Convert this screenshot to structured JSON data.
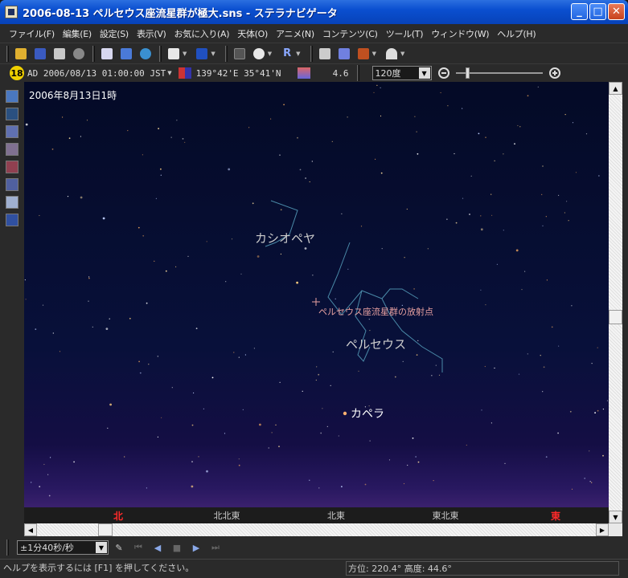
{
  "window": {
    "title": "2006-08-13 ペルセウス座流星群が極大.sns - ステラナビゲータ"
  },
  "menu": [
    {
      "id": "file",
      "label": "ファイル(F)"
    },
    {
      "id": "edit",
      "label": "編集(E)"
    },
    {
      "id": "settings",
      "label": "設定(S)"
    },
    {
      "id": "view",
      "label": "表示(V)"
    },
    {
      "id": "favorites",
      "label": "お気に入り(A)"
    },
    {
      "id": "celestial",
      "label": "天体(O)"
    },
    {
      "id": "anime",
      "label": "アニメ(N)"
    },
    {
      "id": "contents",
      "label": "コンテンツ(C)"
    },
    {
      "id": "tools",
      "label": "ツール(T)"
    },
    {
      "id": "window",
      "label": "ウィンドウ(W)"
    },
    {
      "id": "help",
      "label": "ヘルプ(H)"
    }
  ],
  "status_top": {
    "badge": "18",
    "datetime": "AD  2006/08/13 01:00:00 JST",
    "coords": "139°42'E 35°41'N",
    "magnitude": "4.6",
    "fov": "120度",
    "zoom_level": 0.12
  },
  "sky": {
    "date_label": "2006年8月13日1時",
    "constellations": {
      "cassiopeia": "カシオペヤ",
      "perseus": "ペルセウス"
    },
    "radiant_label": "ペルセウス座流星群の放射点",
    "capella_label": "カペラ",
    "directions": {
      "north": "北",
      "nne": "北北東",
      "ne": "北東",
      "ene": "東北東",
      "east": "東"
    }
  },
  "anim": {
    "speed": "±1分40秒/秒"
  },
  "status_bottom": {
    "help": "ヘルプを表示するには [F1] を押してください。",
    "position": "方位: 220.4°  高度:  44.6°"
  },
  "colors": {
    "title_bar": "#0a4fd0",
    "sky_top": "#040a26",
    "sky_horizon": "#4a2878",
    "constellation_line": "#4a8aa8",
    "direction_major": "#ff2a2a",
    "radiant": "#e7a0a0"
  }
}
